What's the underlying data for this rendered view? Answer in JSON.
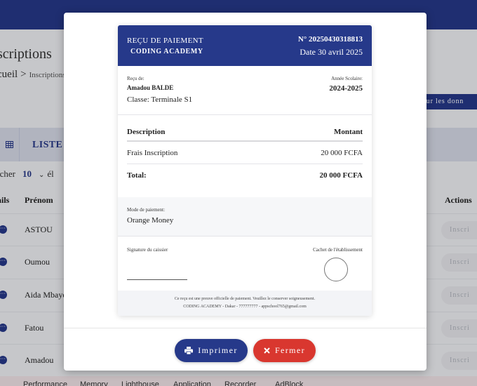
{
  "background": {
    "page_title": "scriptions",
    "breadcrumb": {
      "home": "cueil",
      "separator": ">",
      "current": "Inscriptions"
    },
    "export_button": "our les donn",
    "list_title": "LISTE I",
    "filter": {
      "label": "icher",
      "count": "10",
      "suffix": "él"
    },
    "table_headers": {
      "details": "ails",
      "prenom": "Prénom",
      "actions": "Actions"
    },
    "rows": [
      {
        "prenom": "ASTOU",
        "action": "Inscri"
      },
      {
        "prenom": "Oumou",
        "action": "Inscri"
      },
      {
        "prenom": "Aida Mbaye",
        "action": "Inscri"
      },
      {
        "prenom": "Fatou",
        "action": "Inscri"
      },
      {
        "prenom": "Amadou",
        "action": "Inscri"
      }
    ],
    "devtools_tabs": [
      "Performance",
      "Memory",
      "Lighthouse",
      "Application",
      "Recorder",
      "AdBlock"
    ]
  },
  "receipt": {
    "header_label": "REÇU DE PAIEMENT",
    "school_name": "CODING ACADEMY",
    "receipt_number": "N° 20250430318813",
    "date": "Date 30 avril 2025",
    "recu_de_label": "Reçu de:",
    "student_name": "Amadou BALDE",
    "classe": "Classe: Terminale S1",
    "annee_label": "Année Scolaire:",
    "annee": "2024-2025",
    "table": {
      "col_description": "Description",
      "col_montant": "Montant",
      "item_description": "Frais Inscription",
      "item_amount": "20 000 FCFA",
      "total_label": "Total:",
      "total_amount": "20 000 FCFA"
    },
    "payment_label": "Mode de paiement:",
    "payment_mode": "Orange Money",
    "signature_label": "Signature du caissier",
    "stamp_label": "Cachet de l'établissement",
    "footer_line1": "Ce reçu est une preuve officielle de paiement. Veuillez le conserver soigneusement.",
    "footer_line2": "CODING ACADEMY - Dakar - 777777777 - appschool765@gmail.com"
  },
  "actions": {
    "print_label": "Imprimer",
    "close_label": "Fermer"
  },
  "colors": {
    "primary": "#26398a",
    "danger": "#d9372f"
  },
  "icons": {
    "print": "printer-icon",
    "close": "close-icon",
    "list": "table-icon",
    "row_details": "more-icon"
  }
}
